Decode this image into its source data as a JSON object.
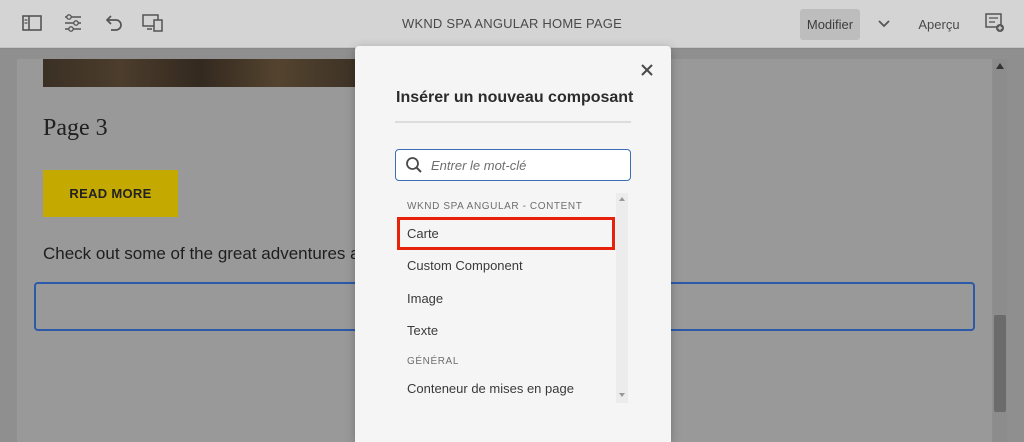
{
  "toolbar": {
    "page_title": "WKND SPA ANGULAR HOME PAGE",
    "modifier_label": "Modifier",
    "apercu_label": "Aperçu",
    "icons": [
      "side-panel-icon",
      "page-properties-icon",
      "undo-icon",
      "emulator-icon",
      "annotations-icon",
      "chevron-down-icon"
    ]
  },
  "page": {
    "title": "Page 3",
    "read_more_label": "READ MORE",
    "body_text": "Check out some of the great adventures a",
    "colors": {
      "button": "#c4aa00",
      "dropzone_border": "#2c5aa8"
    }
  },
  "dialog": {
    "title": "Insérer un nouveau composant",
    "search_placeholder": "Entrer le mot-clé",
    "search_value": "",
    "groups": [
      {
        "header": "WKND SPA ANGULAR - CONTENT",
        "items": [
          "Carte",
          "Custom Component",
          "Image",
          "Texte"
        ]
      },
      {
        "header": "GÉNÉRAL",
        "items": [
          "Conteneur de mises en page"
        ]
      }
    ],
    "highlight_color": "#e8220a"
  }
}
